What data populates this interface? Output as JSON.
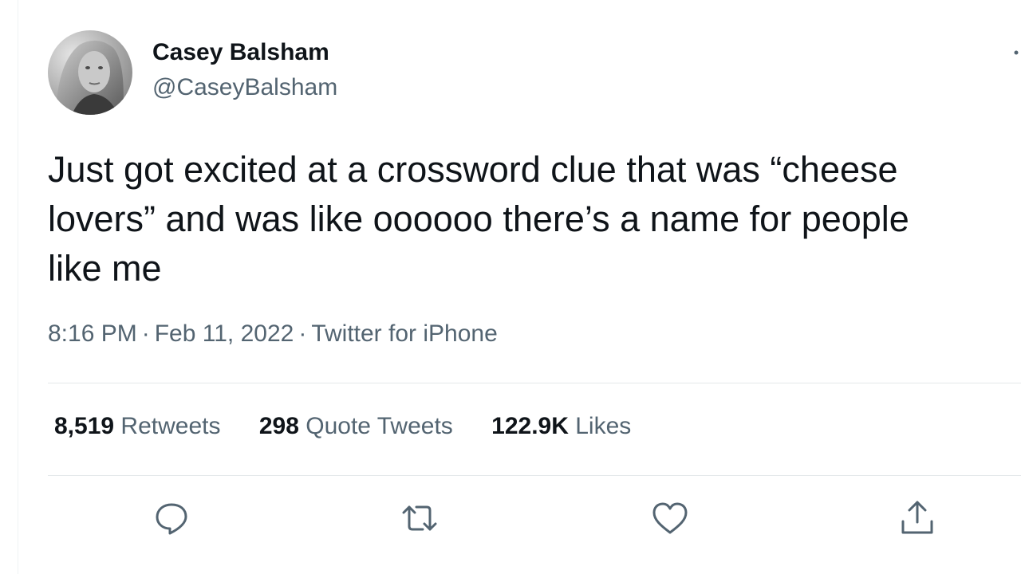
{
  "user": {
    "display_name": "Casey Balsham",
    "handle": "@CaseyBalsham"
  },
  "tweet": {
    "text_lines": [
      "Just got excited at a crossword clue that was “cheese",
      "lovers” and was like oooooo there’s a name for people",
      "like me"
    ],
    "time": "8:16 PM",
    "separator": "·",
    "date": "Feb 11, 2022",
    "source": "Twitter for iPhone"
  },
  "stats": {
    "retweets": {
      "count": "8,519",
      "label": "Retweets"
    },
    "quote_tweets": {
      "count": "298",
      "label": "Quote Tweets"
    },
    "likes": {
      "count": "122.9K",
      "label": "Likes"
    }
  },
  "icons": {
    "more": "more-icon",
    "reply": "reply-icon",
    "retweet": "retweet-icon",
    "like": "heart-icon",
    "share": "share-icon"
  },
  "colors": {
    "text_primary": "#0f1419",
    "text_secondary": "#536471",
    "divider": "#e4e8ea"
  }
}
